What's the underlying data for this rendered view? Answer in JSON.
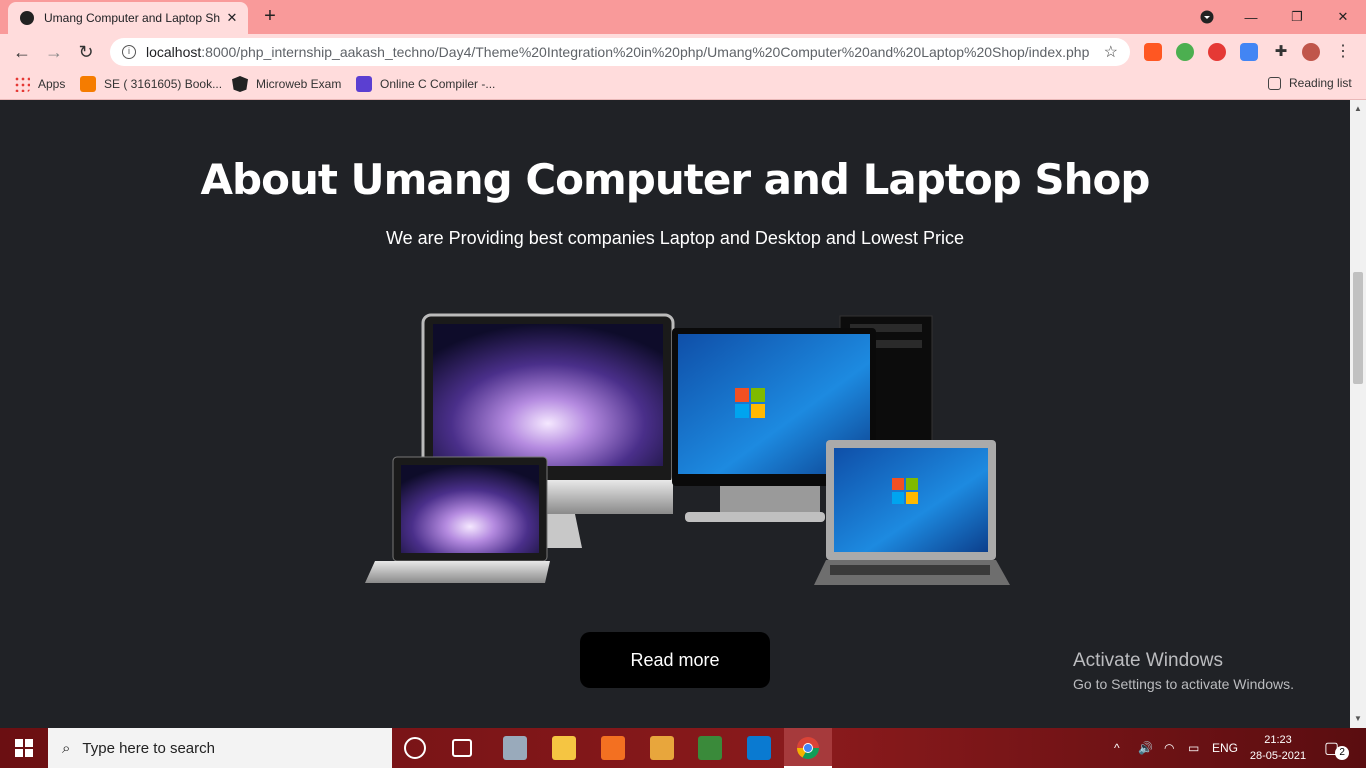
{
  "browser": {
    "tab_title": "Umang Computer and Laptop Sh",
    "url_host": "localhost",
    "url_rest": ":8000/php_internship_aakash_techno/Day4/Theme%20Integration%20in%20php/Umang%20Computer%20and%20Laptop%20Shop/index.php",
    "bookmarks": [
      "Apps",
      "SE ( 3161605) Book...",
      "Microweb Exam",
      "Online C Compiler -..."
    ],
    "reading_list": "Reading list"
  },
  "page": {
    "title": "About Umang Computer and Laptop Shop",
    "subtitle": "We are Providing best companies Laptop and Desktop and Lowest Price",
    "read_more": "Read more"
  },
  "watermark": {
    "line1": "Activate Windows",
    "line2": "Go to Settings to activate Windows."
  },
  "taskbar": {
    "search_placeholder": "Type here to search",
    "lang": "ENG",
    "time": "21:23",
    "date": "28-05-2021",
    "notifications": "2"
  }
}
